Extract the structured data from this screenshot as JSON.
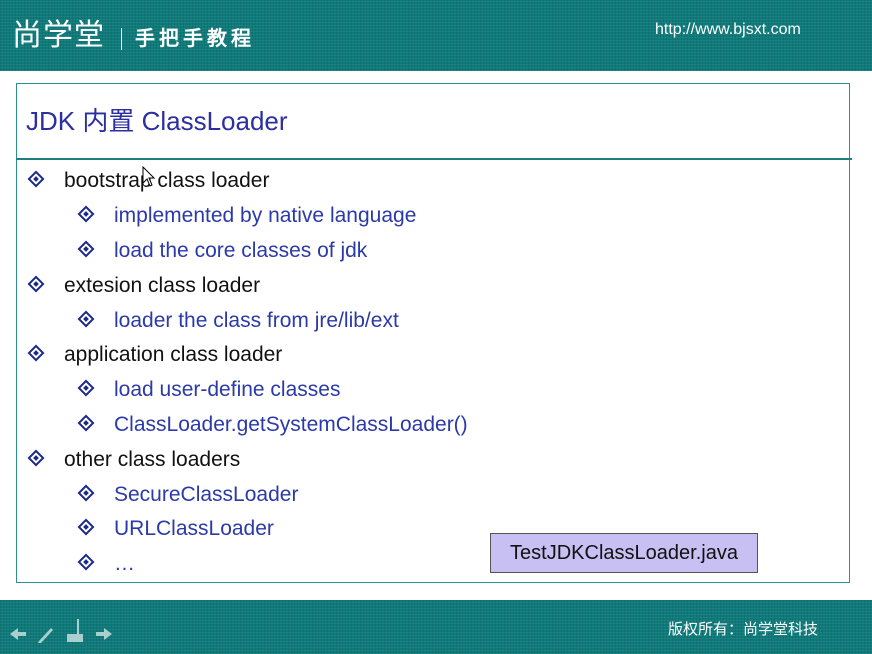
{
  "header": {
    "brand": "尚学堂",
    "tagline": "手把手教程",
    "url": "http://www.bjsxt.com"
  },
  "slide": {
    "title": "JDK 内置 ClassLoader",
    "bullets": [
      {
        "text": "bootstrap class loader",
        "level": 1
      },
      {
        "text": "implemented by native language",
        "level": 2
      },
      {
        "text": "load the core classes of jdk",
        "level": 2
      },
      {
        "text": "extesion class loader",
        "level": 1
      },
      {
        "text": "loader the class from jre/lib/ext",
        "level": 2
      },
      {
        "text": "application class loader",
        "level": 1
      },
      {
        "text": "load user-define classes",
        "level": 2
      },
      {
        "text": "ClassLoader.getSystemClassLoader()",
        "level": 2
      },
      {
        "text": "other class loaders",
        "level": 1
      },
      {
        "text": "SecureClassLoader",
        "level": 2
      },
      {
        "text": "URLClassLoader",
        "level": 2
      },
      {
        "text": "…",
        "level": 2
      }
    ],
    "file_tag": "TestJDKClassLoader.java"
  },
  "footer": {
    "copyright": "版权所有：尚学堂科技",
    "nav_icons": [
      "arrow-left-icon",
      "pen-icon",
      "slide-menu-icon",
      "arrow-right-icon"
    ]
  },
  "colors": {
    "header_bg": "#0f7a7a",
    "title_text": "#2b2fa0",
    "level2_text": "#2b3aa8",
    "file_tag_bg": "#c8bff2"
  }
}
